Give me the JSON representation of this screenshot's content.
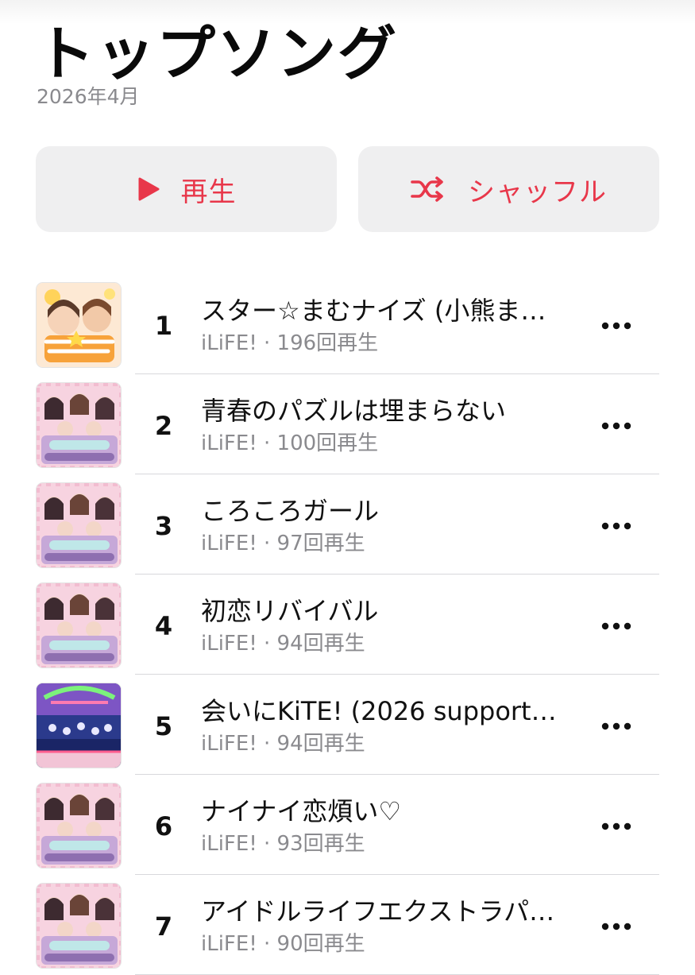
{
  "header": {
    "title": "トップソング",
    "subtitle": "2026年4月"
  },
  "actions": {
    "play_label": "再生",
    "play_icon": "play-icon",
    "shuffle_label": "シャッフル",
    "shuffle_icon": "shuffle-icon",
    "accent_color": "#e8374a",
    "button_bg": "#efeff0"
  },
  "songs": [
    {
      "rank": "1",
      "title": "スター☆まむナイズ (小熊ま…",
      "artist": "iLiFE! ·",
      "plays": "196回再生",
      "artwork": "yellow-single-artwork"
    },
    {
      "rank": "2",
      "title": "青春のパズルは埋まらない",
      "artist": "iLiFE! ·",
      "plays": "100回再生",
      "artwork": "pink-group-artwork"
    },
    {
      "rank": "3",
      "title": "ころころガール",
      "artist": "iLiFE! ·",
      "plays": "97回再生",
      "artwork": "pink-group-artwork"
    },
    {
      "rank": "4",
      "title": "初恋リバイバル",
      "artist": "iLiFE! ·",
      "plays": "94回再生",
      "artwork": "pink-group-artwork"
    },
    {
      "rank": "5",
      "title": "会いにKiTE! (2026 support…",
      "artist": "iLiFE! ·",
      "plays": "94回再生",
      "artwork": "stage-live-artwork"
    },
    {
      "rank": "6",
      "title": "ナイナイ恋煩い♡",
      "artist": "iLiFE! ·",
      "plays": "93回再生",
      "artwork": "pink-group-artwork"
    },
    {
      "rank": "7",
      "title": "アイドルライフエクストラパ…",
      "artist": "iLiFE! ·",
      "plays": "90回再生",
      "artwork": "pink-group-artwork"
    }
  ]
}
